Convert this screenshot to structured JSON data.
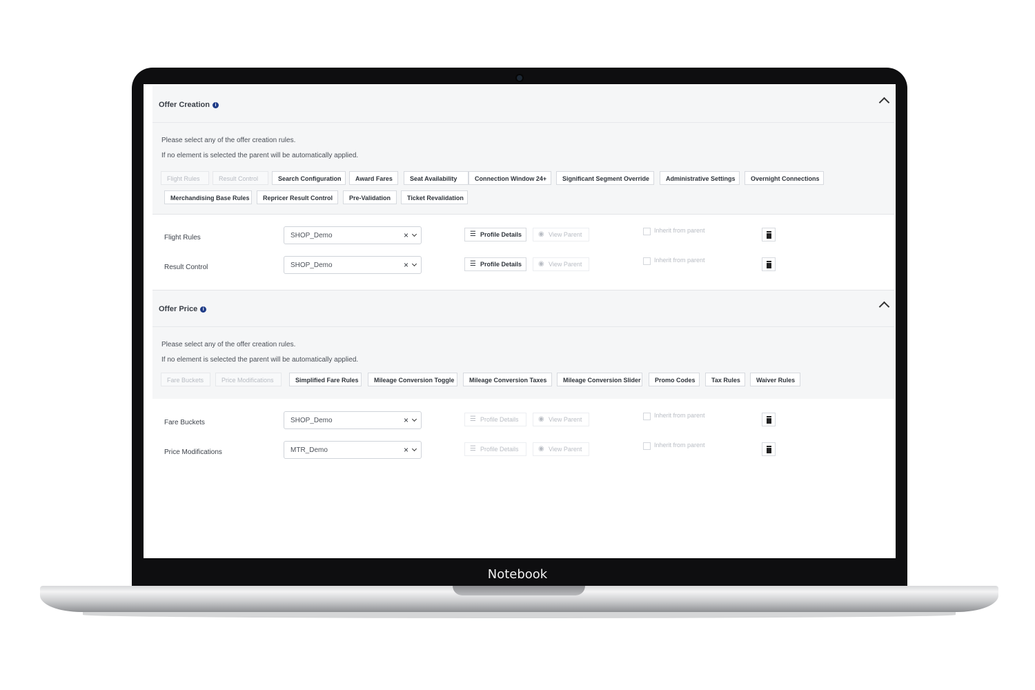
{
  "device": {
    "label": "Notebook"
  },
  "offer_creation": {
    "title": "Offer Creation",
    "hint_line1": "Please select any of the offer creation rules.",
    "hint_line2": "If no element is selected the parent will be automatically applied.",
    "chips": [
      {
        "label": "Flight Rules",
        "disabled": true
      },
      {
        "label": "Result Control",
        "disabled": true
      },
      {
        "label": "Search Configuration",
        "disabled": false
      },
      {
        "label": "Award Fares",
        "disabled": false
      },
      {
        "label": "Seat Availability",
        "disabled": false
      },
      {
        "label": "Connection Window 24+",
        "disabled": false
      },
      {
        "label": "Significant Segment Override",
        "disabled": false
      },
      {
        "label": "Administrative Settings",
        "disabled": false
      },
      {
        "label": "Overnight Connections",
        "disabled": false
      },
      {
        "label": "Merchandising Base Rules",
        "disabled": false
      },
      {
        "label": "Repricer Result Control",
        "disabled": false
      },
      {
        "label": "Pre-Validation",
        "disabled": false
      },
      {
        "label": "Ticket Revalidation",
        "disabled": false
      }
    ],
    "rows": [
      {
        "label": "Flight Rules",
        "value": "SHOP_Demo",
        "profile_details": "Profile Details",
        "view_parent": "View Parent",
        "inherit": "Inherit from parent",
        "profile_enabled": true
      },
      {
        "label": "Result Control",
        "value": "SHOP_Demo",
        "profile_details": "Profile Details",
        "view_parent": "View Parent",
        "inherit": "Inherit from parent",
        "profile_enabled": true
      }
    ]
  },
  "offer_price": {
    "title": "Offer Price",
    "hint_line1": "Please select any of the offer creation rules.",
    "hint_line2": "If no element is selected the parent will be automatically applied.",
    "chips": [
      {
        "label": "Fare Buckets",
        "disabled": true
      },
      {
        "label": "Price Modifications",
        "disabled": true
      },
      {
        "label": "Simplified Fare Rules",
        "disabled": false
      },
      {
        "label": "Mileage Conversion Toggle",
        "disabled": false
      },
      {
        "label": "Mileage Conversion Taxes",
        "disabled": false
      },
      {
        "label": "Mileage Conversion Slider",
        "disabled": false
      },
      {
        "label": "Promo Codes",
        "disabled": false
      },
      {
        "label": "Tax Rules",
        "disabled": false
      },
      {
        "label": "Waiver Rules",
        "disabled": false
      }
    ],
    "rows": [
      {
        "label": "Fare Buckets",
        "value": "SHOP_Demo",
        "profile_details": "Profile Details",
        "view_parent": "View Parent",
        "inherit": "Inherit from parent",
        "profile_enabled": false
      },
      {
        "label": "Price Modifications",
        "value": "MTR_Demo",
        "profile_details": "Profile Details",
        "view_parent": "View Parent",
        "inherit": "Inherit from parent",
        "profile_enabled": false
      }
    ]
  }
}
